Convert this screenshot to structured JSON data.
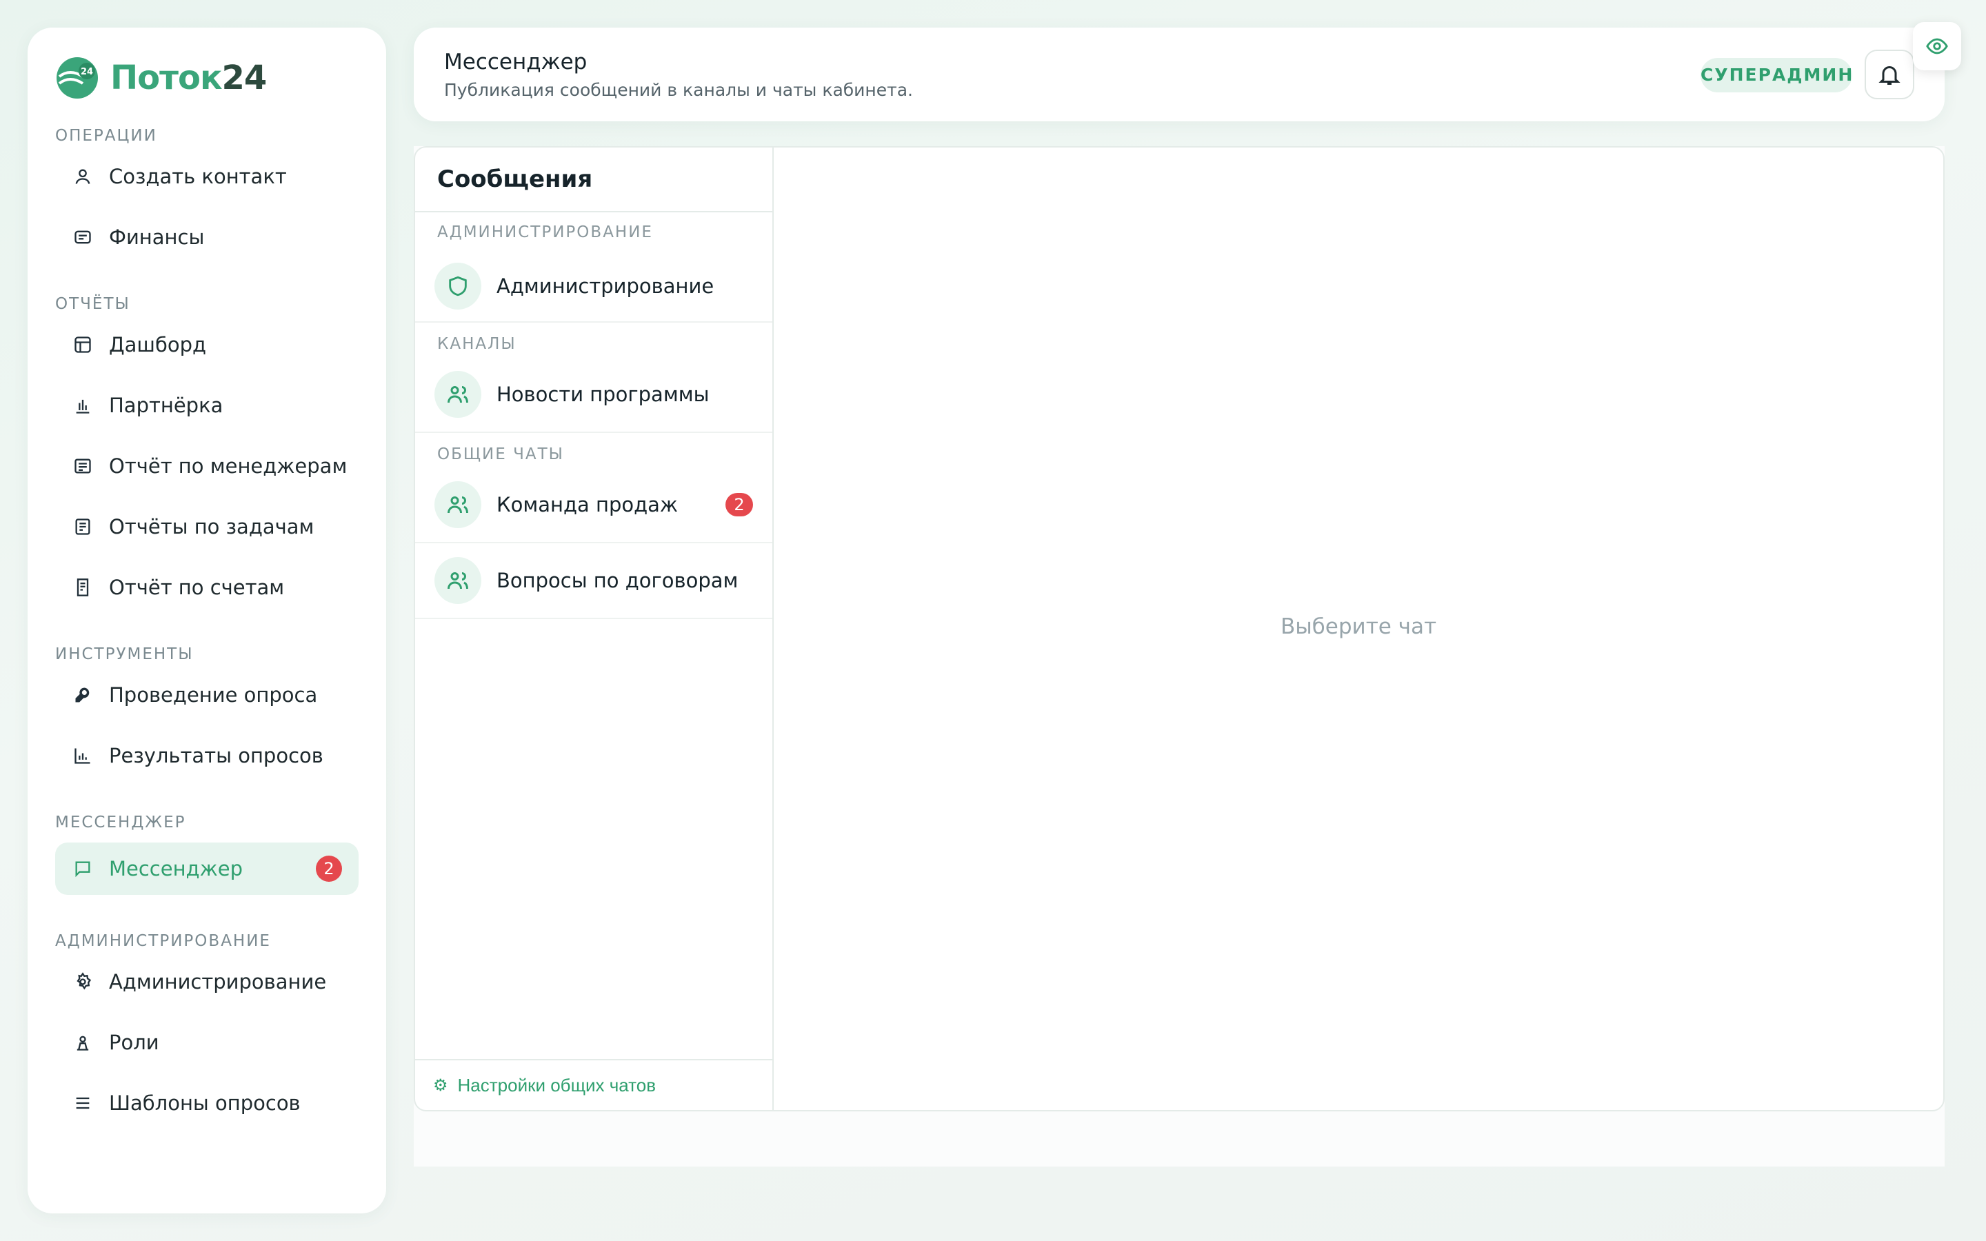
{
  "brand": {
    "name": "Поток",
    "number": "24",
    "mark_text": "24"
  },
  "sidebar": {
    "sections": [
      {
        "title": "ОПЕРАЦИИ",
        "items": [
          {
            "label": "Создать контакт",
            "icon": "user-icon"
          },
          {
            "label": "Финансы",
            "icon": "wallet-icon"
          }
        ]
      },
      {
        "title": "ОТЧЁТЫ",
        "items": [
          {
            "label": "Дашборд",
            "icon": "table-icon"
          },
          {
            "label": "Партнёрка",
            "icon": "bar-chart-icon"
          },
          {
            "label": "Отчёт по менеджерам",
            "icon": "report-icon"
          },
          {
            "label": "Отчёты по задачам",
            "icon": "tasks-icon"
          },
          {
            "label": "Отчёт по счетам",
            "icon": "receipt-icon"
          }
        ]
      },
      {
        "title": "ИНСТРУМЕНТЫ",
        "items": [
          {
            "label": "Проведение опроса",
            "icon": "wrench-icon"
          },
          {
            "label": "Результаты опросов",
            "icon": "chart-icon"
          }
        ]
      },
      {
        "title": "МЕССЕНДЖЕР",
        "items": [
          {
            "label": "Мессенджер",
            "icon": "message-icon",
            "badge": "2",
            "active": true
          }
        ]
      },
      {
        "title": "АДМИНИСТРИРОВАНИЕ",
        "items": [
          {
            "label": "Администрирование",
            "icon": "gear-icon"
          },
          {
            "label": "Роли",
            "icon": "role-icon"
          },
          {
            "label": "Шаблоны опросов",
            "icon": "list-icon"
          }
        ]
      }
    ]
  },
  "header": {
    "title": "Мессенджер",
    "subtitle": "Публикация сообщений в каналы и чаты кабинета.",
    "role": "СУПЕРАДМИН"
  },
  "chat_list": {
    "title": "Сообщения",
    "groups": [
      {
        "title": "АДМИНИСТРИРОВАНИЕ",
        "chats": [
          {
            "name": "Администрирование",
            "icon": "shield-icon"
          }
        ]
      },
      {
        "title": "КАНАЛЫ",
        "chats": [
          {
            "name": "Новости программы",
            "icon": "users-icon"
          }
        ]
      },
      {
        "title": "ОБЩИЕ ЧАТЫ",
        "chats": [
          {
            "name": "Команда продаж",
            "icon": "users-icon",
            "badge": "2"
          },
          {
            "name": "Вопросы по договорам",
            "icon": "users-icon"
          }
        ]
      }
    ],
    "footer_icon": "⚙",
    "footer_label": "Настройки общих чатов"
  },
  "chat_pane": {
    "empty_text": "Выберите чат"
  },
  "colors": {
    "accent": "#2f9f6e",
    "badge": "#e5484d"
  }
}
